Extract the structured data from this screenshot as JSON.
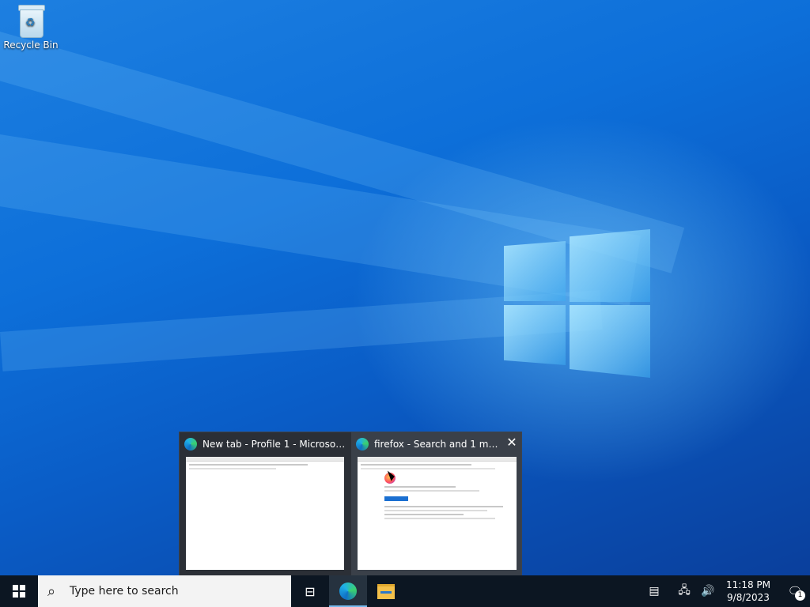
{
  "desktop": {
    "icons": [
      {
        "label": "Recycle Bin",
        "icon": "recycle-bin-icon"
      }
    ]
  },
  "preview": {
    "windows": [
      {
        "title": "New tab - Profile 1 - Microsoft ...",
        "icon": "edge-icon"
      },
      {
        "title": "firefox - Search and 1 mo...",
        "icon": "edge-icon",
        "close": "✕"
      }
    ]
  },
  "taskbar": {
    "search_placeholder": "Type here to search",
    "search_icon": "⌕",
    "task_view_icon": "⊟",
    "pinned": [
      "task-view-icon",
      "edge-icon",
      "file-explorer-icon"
    ],
    "tray": {
      "news_icon": "▤",
      "network_icon": "🖧",
      "volume_icon": "🔊",
      "time": "11:18 PM",
      "date": "9/8/2023",
      "notification_icon": "🗨",
      "notification_count": "1"
    }
  },
  "colors": {
    "accent": "#76b9ed",
    "taskbar": "#0c1622",
    "desktop": "#0d6fd9"
  }
}
